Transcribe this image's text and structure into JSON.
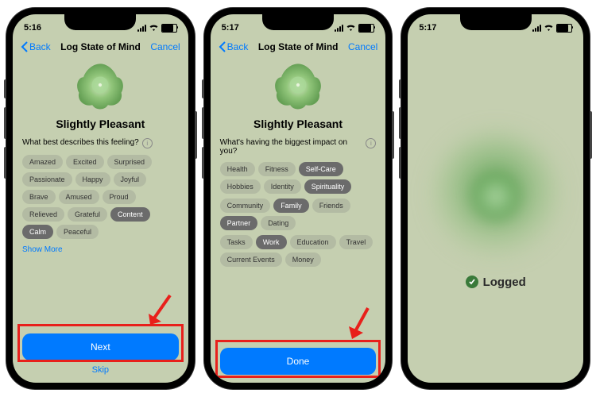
{
  "s1": {
    "time": "5:16",
    "back": "Back",
    "title": "Log State of Mind",
    "cancel": "Cancel",
    "mood": "Slightly Pleasant",
    "prompt": "What best describes this feeling?",
    "chips": [
      {
        "t": "Amazed",
        "s": false
      },
      {
        "t": "Excited",
        "s": false
      },
      {
        "t": "Surprised",
        "s": false
      },
      {
        "t": "Passionate",
        "s": false
      },
      {
        "t": "Happy",
        "s": false
      },
      {
        "t": "Joyful",
        "s": false
      },
      {
        "t": "Brave",
        "s": false
      },
      {
        "t": "Amused",
        "s": false
      },
      {
        "t": "Proud",
        "s": false
      },
      {
        "t": "Relieved",
        "s": false
      },
      {
        "t": "Grateful",
        "s": false
      },
      {
        "t": "Content",
        "s": true
      },
      {
        "t": "Calm",
        "s": true
      },
      {
        "t": "Peaceful",
        "s": false
      }
    ],
    "showmore": "Show More",
    "primary": "Next",
    "skip": "Skip"
  },
  "s2": {
    "time": "5:17",
    "back": "Back",
    "title": "Log State of Mind",
    "cancel": "Cancel",
    "mood": "Slightly Pleasant",
    "prompt": "What's having the biggest impact on you?",
    "groups": [
      [
        {
          "t": "Health",
          "s": false
        },
        {
          "t": "Fitness",
          "s": false
        },
        {
          "t": "Self-Care",
          "s": true
        },
        {
          "t": "Hobbies",
          "s": false
        },
        {
          "t": "Identity",
          "s": false
        },
        {
          "t": "Spirituality",
          "s": true
        }
      ],
      [
        {
          "t": "Community",
          "s": false
        },
        {
          "t": "Family",
          "s": true
        },
        {
          "t": "Friends",
          "s": false
        },
        {
          "t": "Partner",
          "s": true
        },
        {
          "t": "Dating",
          "s": false
        }
      ],
      [
        {
          "t": "Tasks",
          "s": false
        },
        {
          "t": "Work",
          "s": true
        },
        {
          "t": "Education",
          "s": false
        },
        {
          "t": "Travel",
          "s": false
        },
        {
          "t": "Current Events",
          "s": false
        },
        {
          "t": "Money",
          "s": false
        }
      ]
    ],
    "primary": "Done"
  },
  "s3": {
    "time": "5:17",
    "logged": "Logged"
  }
}
